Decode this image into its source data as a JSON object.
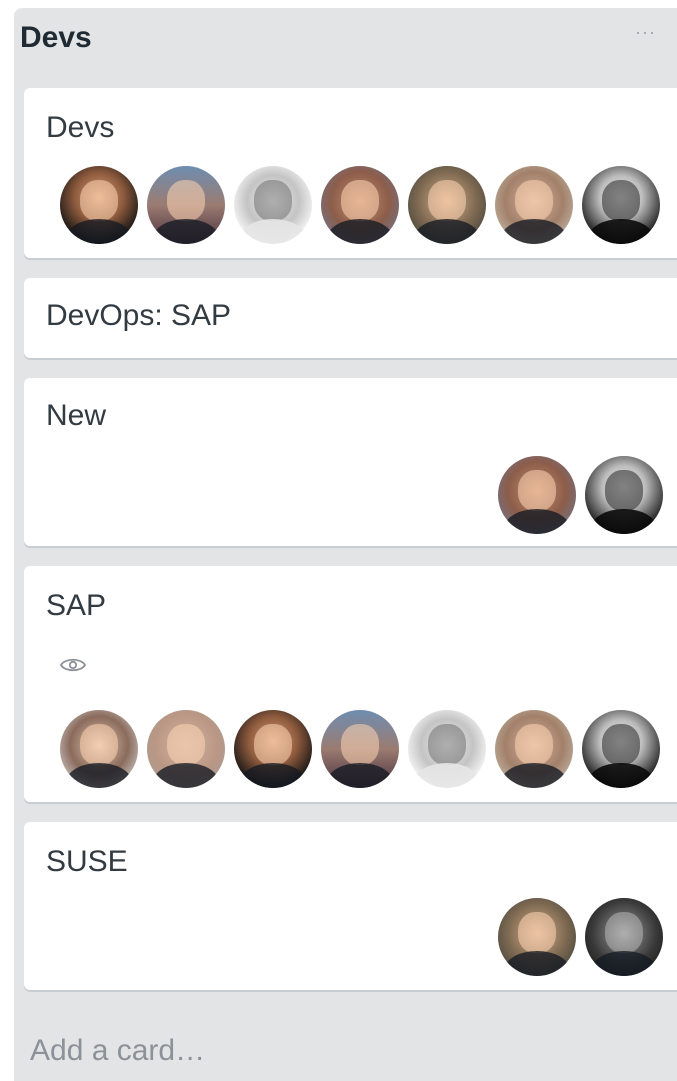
{
  "list": {
    "title": "Devs",
    "menu_icon": "ellipsis-icon",
    "menu_glyph": "···",
    "background": "#e2e4e6",
    "add_card_label": "Add a card…"
  },
  "cards": [
    {
      "title": "Devs",
      "members": [
        "bald",
        "blur",
        "bw",
        "beard",
        "glasses",
        "warm",
        "dark"
      ]
    },
    {
      "title": "DevOps: SAP",
      "members": []
    },
    {
      "title": "New",
      "members": [
        "beard",
        "dark"
      ]
    },
    {
      "title": "SAP",
      "watch_icon": "eye-icon",
      "members": [
        "smile",
        "fade",
        "bald",
        "blur",
        "bw",
        "warm",
        "dark"
      ]
    },
    {
      "title": "SUSE",
      "members": [
        "glasses",
        "mono"
      ]
    }
  ]
}
